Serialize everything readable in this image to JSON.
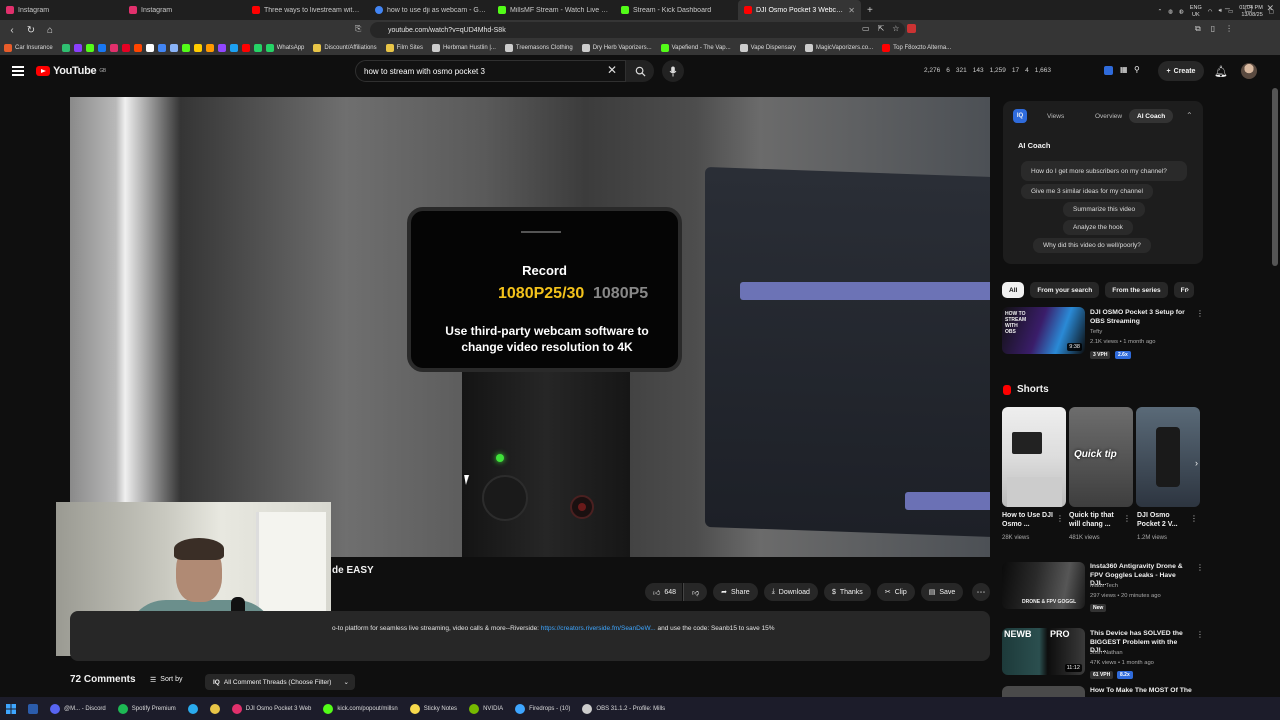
{
  "browser": {
    "tabs": [
      {
        "label": "Instagram",
        "color": "#e1306c"
      },
      {
        "label": "Instagram",
        "color": "#e1306c"
      },
      {
        "label": "Three ways to livestream with the DJ",
        "color": "#ff0000"
      },
      {
        "label": "how to use dji as webcam - Google S",
        "color": "#4285f4"
      },
      {
        "label": "MillsMF Stream - Watch Live on Kick",
        "color": "#53fc18"
      },
      {
        "label": "Stream - Kick Dashboard",
        "color": "#53fc18"
      },
      {
        "label": "DJI Osmo Pocket 3 Webcam",
        "color": "#ff0000",
        "active": true
      }
    ],
    "url": "youtube.com/watch?v=qUD4Mhd-S8k",
    "bookmarks": [
      {
        "label": "Car Insurance",
        "color": "#e85c2a"
      },
      {
        "label": "",
        "color": "#2fbf71"
      },
      {
        "label": "",
        "color": "#8a3ffc"
      },
      {
        "label": "",
        "color": "#53fc18"
      },
      {
        "label": "",
        "color": "#1877f2"
      },
      {
        "label": "",
        "color": "#e1306c"
      },
      {
        "label": "",
        "color": "#e60023"
      },
      {
        "label": "",
        "color": "#ff4500"
      },
      {
        "label": "",
        "color": "#ffffff"
      },
      {
        "label": "",
        "color": "#4285f4"
      },
      {
        "label": "",
        "color": "#8ab4f8"
      },
      {
        "label": "",
        "color": "#53fc18"
      },
      {
        "label": "",
        "color": "#ffcc00"
      },
      {
        "label": "",
        "color": "#ff9900"
      },
      {
        "label": "",
        "color": "#9146ff"
      },
      {
        "label": "",
        "color": "#1da1f2"
      },
      {
        "label": "",
        "color": "#ff0000"
      },
      {
        "label": "",
        "color": "#25d366"
      },
      {
        "label": "WhatsApp",
        "color": "#25d366"
      },
      {
        "label": "Discount/Affiliations",
        "color": "#e8c547"
      },
      {
        "label": "Film Sites",
        "color": "#e8c547"
      },
      {
        "label": "Herbman Hustlin |...",
        "color": "#cccccc"
      },
      {
        "label": "Treemasons Clothing",
        "color": "#cccccc"
      },
      {
        "label": "Dry Herb Vaporizers...",
        "color": "#cccccc"
      },
      {
        "label": "Vapefiend - The Vap...",
        "color": "#53fc18"
      },
      {
        "label": "Vape Dispensary",
        "color": "#cccccc"
      },
      {
        "label": "MagicVaporizers.co...",
        "color": "#cccccc"
      },
      {
        "label": "Top F8oxzto Alterna...",
        "color": "#ff0000"
      }
    ]
  },
  "youtube": {
    "logo_text": "YouTube",
    "logo_region": "GB",
    "search_query": "how to stream with osmo pocket 3",
    "stats": [
      "2,276",
      "6",
      "321",
      "143",
      "1,259",
      "17",
      "4",
      "1,663"
    ],
    "create_label": "Create"
  },
  "video": {
    "screen_record": "Record",
    "screen_res_active": "1080P25/30",
    "screen_res_other": "1080P5",
    "screen_message": "Use third-party webcam software to change video resolution to 4K",
    "title_tail": "de EASY",
    "likes": "648",
    "share_label": "Share",
    "download_label": "Download",
    "thanks_label": "Thanks",
    "clip_label": "Clip",
    "save_label": "Save",
    "desc_prefix": "o-to platform for seamless live streaming, video calls & more--Riverside:",
    "desc_link": "https://creators.riverside.fm/SeanDeW...",
    "desc_suffix": "and use the code: Seanb15 to save 15%"
  },
  "comments": {
    "count_label": "72 Comments",
    "sort_label": "Sort by",
    "filter_label": "All Comment Threads (Choose Filter)"
  },
  "coach": {
    "logo": "IQ",
    "tabs": [
      "Views",
      "Overview",
      "AI Coach"
    ],
    "title": "AI Coach",
    "questions": [
      "How do I get more subscribers on my channel?",
      "Give me 3 similar ideas for my channel",
      "Summarize this video",
      "Analyze the hook",
      "Why did this video do well/poorly?"
    ]
  },
  "chips": [
    "All",
    "From your search",
    "From the series",
    "Fr"
  ],
  "recs": [
    {
      "title": "DJI OSMO Pocket 3 Setup for OBS Streaming",
      "channel": "Tefty",
      "meta": "2.1K views • 1 month ago",
      "duration": "9:38",
      "vph": "3 VPH",
      "badge": "2.6x"
    },
    {
      "title": "Insta360 Antigravity Drone & FPV Goggles Leaks - Have DJI...",
      "channel": "Mads Tech",
      "meta": "297 views • 20 minutes ago",
      "duration": "",
      "vph": "New",
      "badge": ""
    },
    {
      "title": "This Device has SOLVED the BIGGEST Problem with the DJI...",
      "channel": "Josh Nathan",
      "meta": "47K views • 1 month ago",
      "duration": "11:12",
      "vph": "61 VPH",
      "badge": "8.2x"
    },
    {
      "title": "How To Make The MOST Of The",
      "channel": "",
      "meta": "",
      "duration": "",
      "vph": "",
      "badge": ""
    }
  ],
  "shorts": {
    "heading": "Shorts",
    "items": [
      {
        "title": "How to Use DJI Osmo ...",
        "views": "28K views",
        "overlay": ""
      },
      {
        "title": "Quick tip that will chang ...",
        "views": "481K views",
        "overlay": "Quick tip"
      },
      {
        "title": "DJI Osmo Pocket 2 V...",
        "views": "1.2M views",
        "overlay": ""
      }
    ]
  },
  "thumb_texts": {
    "rec1": "HOW TO STREAM WITH OBS",
    "rec2": "DRONE & FPV GOGGL",
    "rec3_a": "NEWB",
    "rec3_b": "PRO"
  },
  "taskbar": {
    "items": [
      {
        "label": "@M... - Discord",
        "color": "#5865f2"
      },
      {
        "label": "Spotify Premium",
        "color": "#1db954"
      },
      {
        "label": "",
        "color": "#2aabee"
      },
      {
        "label": "",
        "color": "#e8c547"
      },
      {
        "label": "DJI Osmo Pocket 3 Web",
        "color": "#e1306c"
      },
      {
        "label": "kick.com/popout/millsn",
        "color": "#53fc18"
      },
      {
        "label": "Sticky Notes",
        "color": "#f7d94c"
      },
      {
        "label": "NVIDIA",
        "color": "#76b900"
      },
      {
        "label": "Firedrops - (10)",
        "color": "#3ea6ff"
      },
      {
        "label": "OBS 31.1.2 - Profile: Mills",
        "color": "#cccccc"
      }
    ],
    "lang": "ENG",
    "region": "UK",
    "time": "01:04 PM",
    "date": "13/08/25"
  }
}
